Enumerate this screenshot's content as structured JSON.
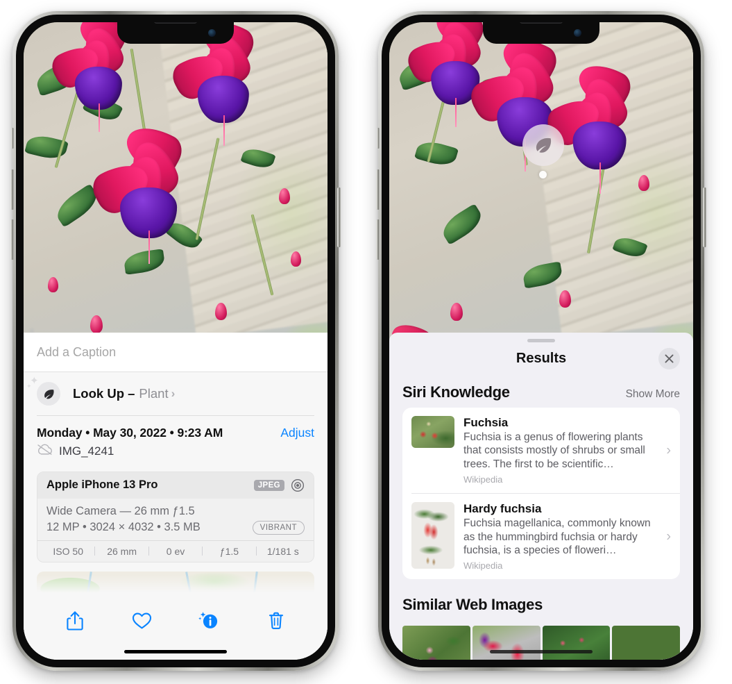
{
  "left_phone": {
    "name": "iphone-photo-info",
    "caption": {
      "placeholder": "Add a Caption",
      "value": ""
    },
    "look_up": {
      "label": "Look Up –",
      "subject": "Plant",
      "chevron": "›",
      "icon": "leaf-icon"
    },
    "date": "Monday • May 30, 2022 • 9:23 AM",
    "adjust": "Adjust",
    "filename": "IMG_4241",
    "filename_icon": "icloud-slash-icon",
    "exif": {
      "device": "Apple iPhone 13 Pro",
      "format_badge": "JPEG",
      "aperture_icon": "aperture-icon",
      "lens": "Wide Camera — 26 mm ƒ1.5",
      "specs": "12 MP • 3024 × 4032 • 3.5 MB",
      "style_badge": "VIBRANT",
      "stats": [
        "ISO 50",
        "26 mm",
        "0 ev",
        "ƒ1.5",
        "1/181 s"
      ]
    },
    "toolbar": [
      {
        "name": "share-button",
        "icon": "share-icon"
      },
      {
        "name": "favorite-button",
        "icon": "heart-icon"
      },
      {
        "name": "info-button",
        "icon": "info-sparkle-icon"
      },
      {
        "name": "delete-button",
        "icon": "trash-icon"
      }
    ]
  },
  "right_phone": {
    "name": "iphone-visual-lookup-results",
    "badge": {
      "icon": "leaf-icon",
      "name": "visual-look-up-badge"
    },
    "sheet": {
      "title": "Results",
      "close_icon": "close-icon",
      "sections": [
        {
          "title": "Siri Knowledge",
          "action": "Show More",
          "cards": [
            {
              "title": "Fuchsia",
              "description": "Fuchsia is a genus of flowering plants that consists mostly of shrubs or small trees. The first to be scientific…",
              "source": "Wikipedia",
              "thumb": "fuchsia-red-flowers-thumb"
            },
            {
              "title": "Hardy fuchsia",
              "description": "Fuchsia magellanica, commonly known as the hummingbird fuchsia or hardy fuchsia, is a species of floweri…",
              "source": "Wikipedia",
              "thumb": "hardy-fuchsia-specimen-thumb"
            }
          ]
        },
        {
          "title": "Similar Web Images",
          "images": [
            {
              "name": "web-image-1",
              "alt": "pink and magenta fuchsia with green leaves"
            },
            {
              "name": "web-image-2",
              "alt": "crimson fuchsia close-up on grey background"
            },
            {
              "name": "web-image-3",
              "alt": "fuchsia shrub with many red buds"
            },
            {
              "name": "web-image-4",
              "alt": "purple and red double fuchsia blooms"
            }
          ]
        }
      ]
    }
  },
  "colors": {
    "accent_blue": "#0a84ff",
    "sheet_bg": "#f1f0f5",
    "panel_bg": "#f7f7f7",
    "card_white": "#ffffff",
    "secondary_text": "#6e6e73",
    "badge_grey": "#a9a9ae"
  }
}
